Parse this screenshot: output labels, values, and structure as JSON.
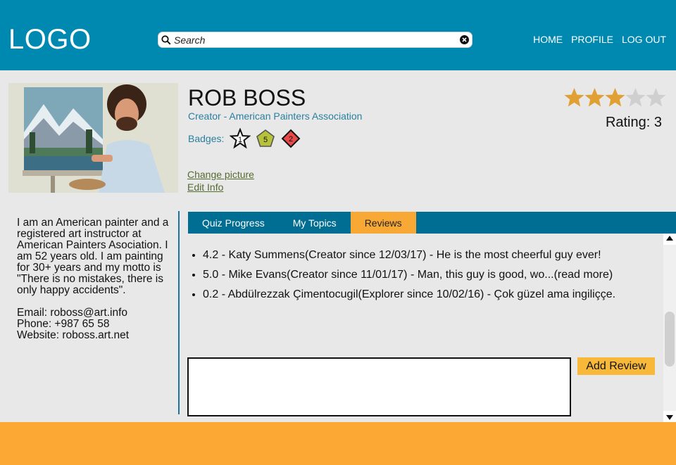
{
  "header": {
    "logo": "LOGO",
    "search_placeholder": "Search",
    "nav": [
      "HOME",
      "PROFILE",
      "LOG OUT"
    ],
    "brand_color": "#0089b0"
  },
  "profile": {
    "name": "ROB BOSS",
    "role": "Creator - American Painters Association",
    "badges_label": "Badges:",
    "badges": [
      {
        "shape": "star-icon",
        "value": "1",
        "color": "#ffffff"
      },
      {
        "shape": "pentagon-icon",
        "value": "5",
        "color": "#b5c23a"
      },
      {
        "shape": "diamond-icon",
        "value": "2",
        "color": "#e84a4a"
      }
    ],
    "change_picture": "Change picture",
    "edit_info": "Edit Info",
    "rating": 3,
    "rating_max": 5,
    "rating_text": "Rating: 3"
  },
  "bio": {
    "about": "I am an American painter and a registered art instructor at American Painters Asociation. I am 52 years old. I am painting for 30+ years and my motto is \"There is no mistakes, there is only happy accidents\".",
    "email": "Email: roboss@art.info",
    "phone": "Phone: +987 65 58",
    "website": "Website: roboss.art.net"
  },
  "tabs": [
    {
      "label": "Quiz Progress",
      "active": false
    },
    {
      "label": "My Topics",
      "active": false
    },
    {
      "label": "Reviews",
      "active": true
    }
  ],
  "reviews": [
    "4.2 - Katy Summens(Creator since 12/03/17) - He is the most cheerful guy ever!",
    "5.0 - Mike Evans(Creator since 11/01/17) - Man, this guy is good, wo...(read more)",
    "0.2 - Abdülrezzak Çimentocugil(Explorer since 10/02/16) - Çok güzel ama ingiliççe."
  ],
  "review_form": {
    "input_value": "",
    "add_button": "Add Review"
  },
  "colors": {
    "accent": "#f8a935",
    "tab_bar": "#006e93",
    "footer": "#fba834"
  }
}
